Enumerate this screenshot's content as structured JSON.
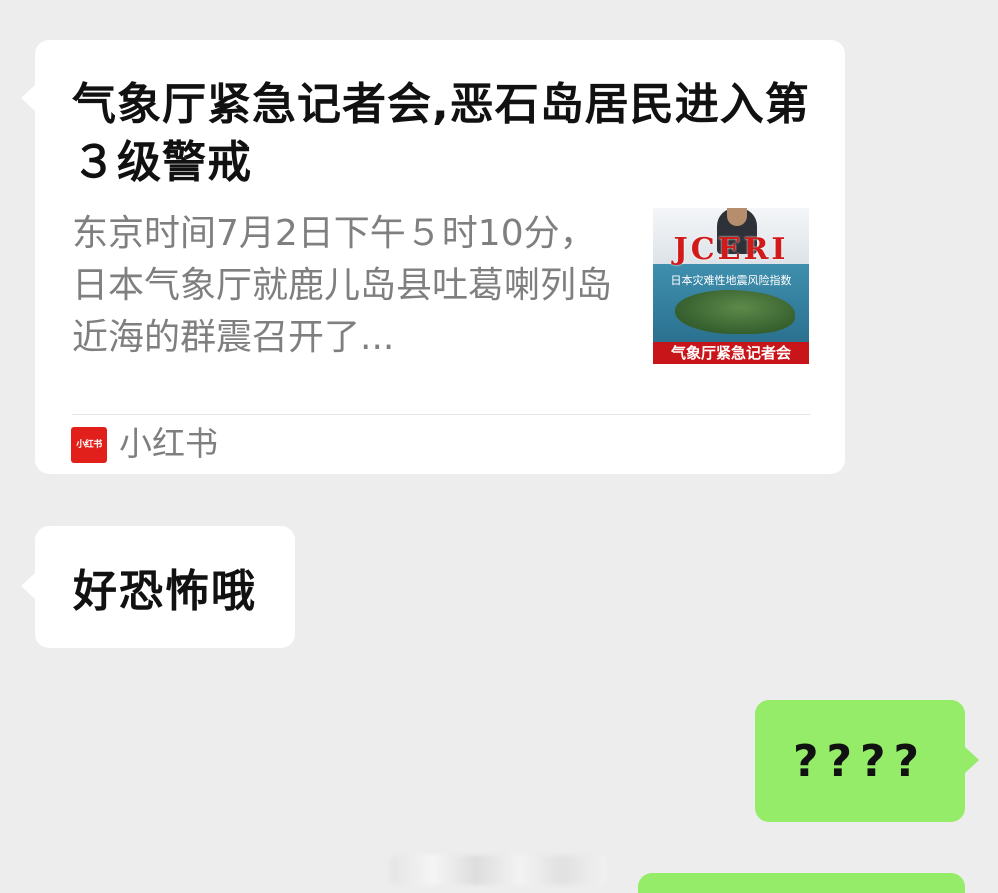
{
  "messages": {
    "link_card": {
      "title": "气象厅紧急记者会,恶石岛居民进入第３级警戒",
      "description": "东京时间7月2日下午５时10分，日本气象厅就鹿儿岛县吐葛喇列岛近海的群震召开了...",
      "thumbnail": {
        "logo_text": "JCERI",
        "subtitle": "日本灾难性地震风险指数",
        "banner": "气象厅紧急记者会"
      },
      "source": {
        "icon_text": "小红书",
        "name": "小红书"
      }
    },
    "incoming_text": "好恐怖哦",
    "outgoing_text": "????"
  },
  "colors": {
    "background": "#ededed",
    "incoming_bubble": "#ffffff",
    "outgoing_bubble": "#95ec69",
    "source_brand": "#e1201c"
  }
}
